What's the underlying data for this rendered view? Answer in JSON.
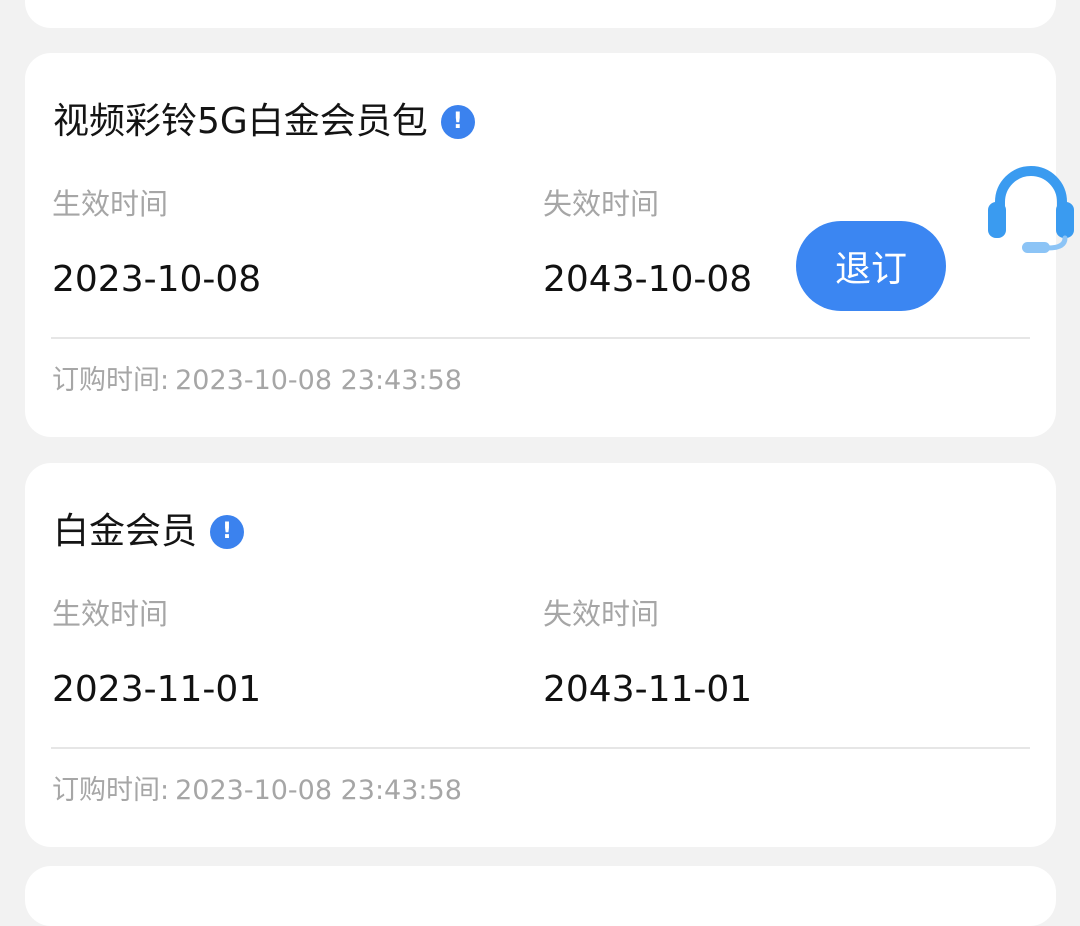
{
  "subscriptions": [
    {
      "title": "视频彩铃5G白金会员包",
      "effective_label": "生效时间",
      "effective_value": "2023-10-08",
      "expire_label": "失效时间",
      "expire_value": "2043-10-08",
      "order_label": "订购时间:",
      "order_value": "2023-10-08 23:43:58",
      "action_label": "退订"
    },
    {
      "title": "白金会员",
      "effective_label": "生效时间",
      "effective_value": "2023-11-01",
      "expire_label": "失效时间",
      "expire_value": "2043-11-01",
      "order_label": "订购时间:",
      "order_value": "2023-10-08 23:43:58"
    }
  ],
  "icons": {
    "info": "info-icon",
    "support": "customer-service-headset-icon"
  },
  "colors": {
    "accent": "#3b86f2",
    "info": "#3b82ee",
    "background": "#f2f2f2",
    "muted_text": "#a6a6a6"
  }
}
